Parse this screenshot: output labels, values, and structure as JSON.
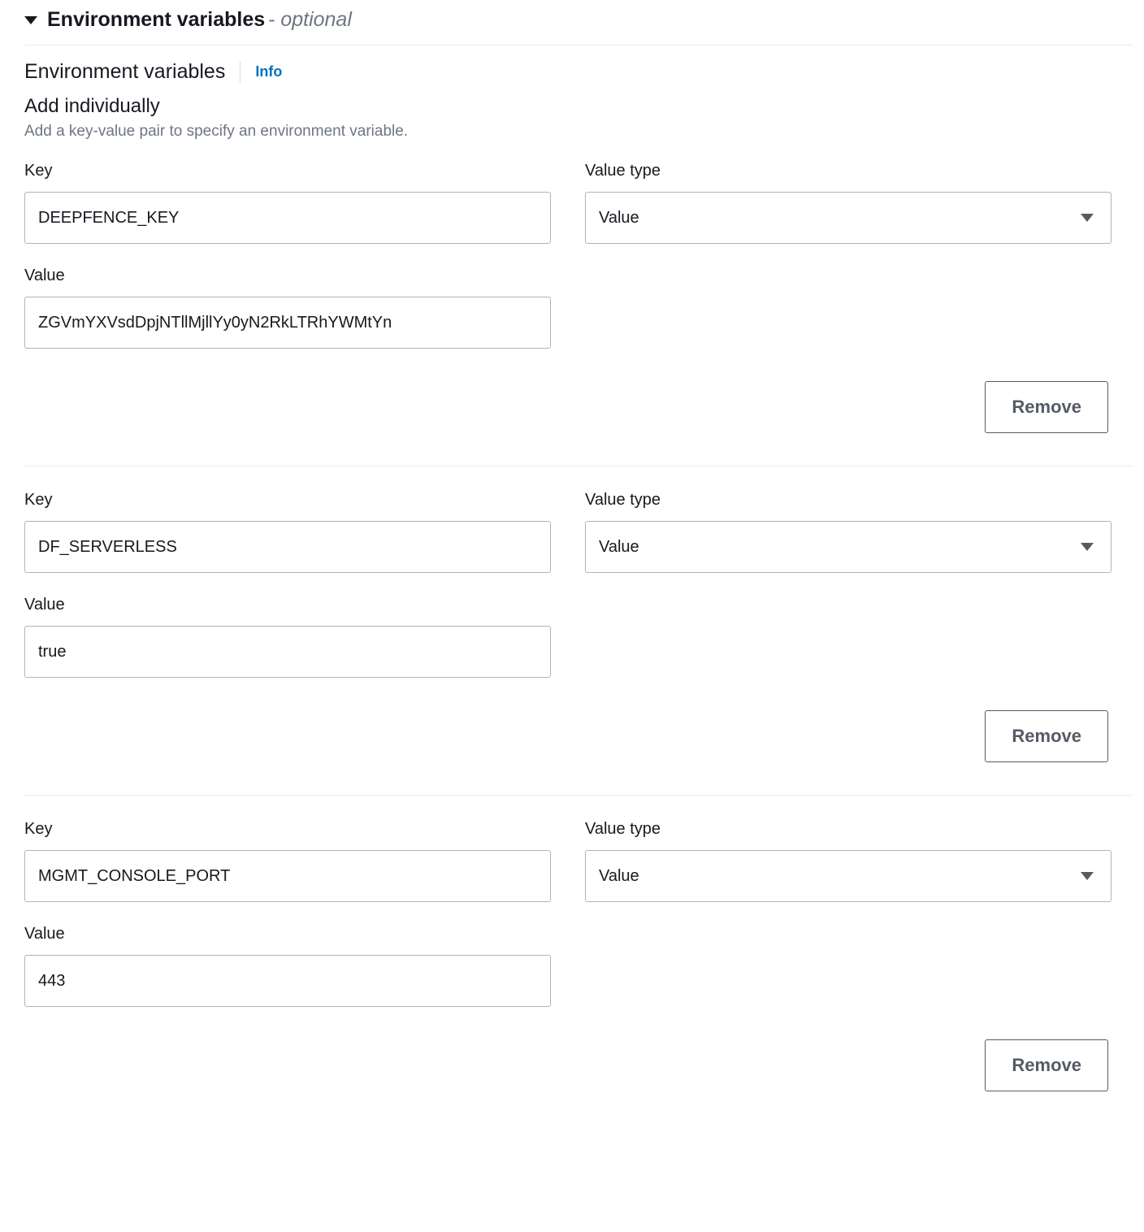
{
  "section": {
    "title": "Environment variables",
    "optional_suffix": "- optional",
    "heading": "Environment variables",
    "info_label": "Info",
    "subtitle": "Add individually",
    "description": "Add a key-value pair to specify an environment variable."
  },
  "labels": {
    "key": "Key",
    "value_type": "Value type",
    "value": "Value",
    "remove": "Remove"
  },
  "value_type_option": "Value",
  "entries": [
    {
      "key": "DEEPFENCE_KEY",
      "value_type": "Value",
      "value": "ZGVmYXVsdDpjNTllMjllYy0yN2RkLTRhYWMtYn"
    },
    {
      "key": "DF_SERVERLESS",
      "value_type": "Value",
      "value": "true"
    },
    {
      "key": "MGMT_CONSOLE_PORT",
      "value_type": "Value",
      "value": "443"
    }
  ]
}
